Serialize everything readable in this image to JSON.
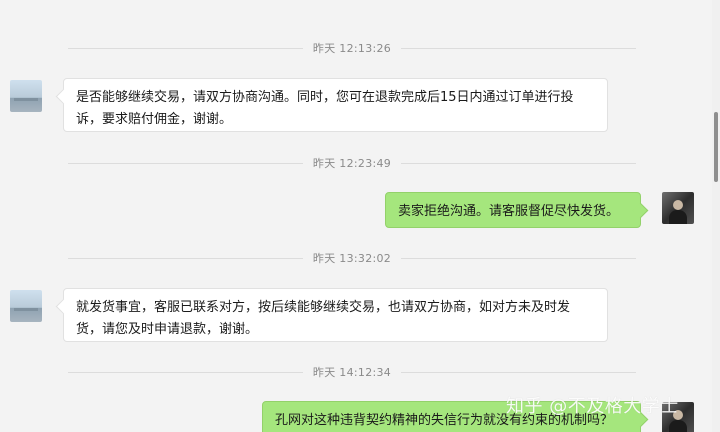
{
  "messages": [
    {
      "type": "timestamp",
      "text": "昨天 12:13:26"
    },
    {
      "type": "message",
      "side": "left",
      "text": "是否能够继续交易，请双方协商沟通。同时，您可在退款完成后15日内通过订单进行投诉，要求赔付佣金，谢谢。"
    },
    {
      "type": "timestamp",
      "text": "昨天 12:23:49"
    },
    {
      "type": "message",
      "side": "right",
      "text": "卖家拒绝沟通。请客服督促尽快发货。"
    },
    {
      "type": "timestamp",
      "text": "昨天 13:32:02"
    },
    {
      "type": "message",
      "side": "left",
      "text": "就发货事宜，客服已联系对方，按后续能够继续交易，也请双方协商，如对方未及时发货，请您及时申请退款，谢谢。"
    },
    {
      "type": "timestamp",
      "text": "昨天 14:12:34"
    },
    {
      "type": "message",
      "side": "right",
      "text": "孔网对这种违背契约精神的失信行为就没有约束的机制吗？"
    }
  ],
  "watermark": "知乎 @不及格大学士",
  "colors": {
    "background": "#f3f3f3",
    "left_bubble": "#ffffff",
    "right_bubble": "#a5e67d",
    "timestamp_text": "#8a8a8a"
  }
}
